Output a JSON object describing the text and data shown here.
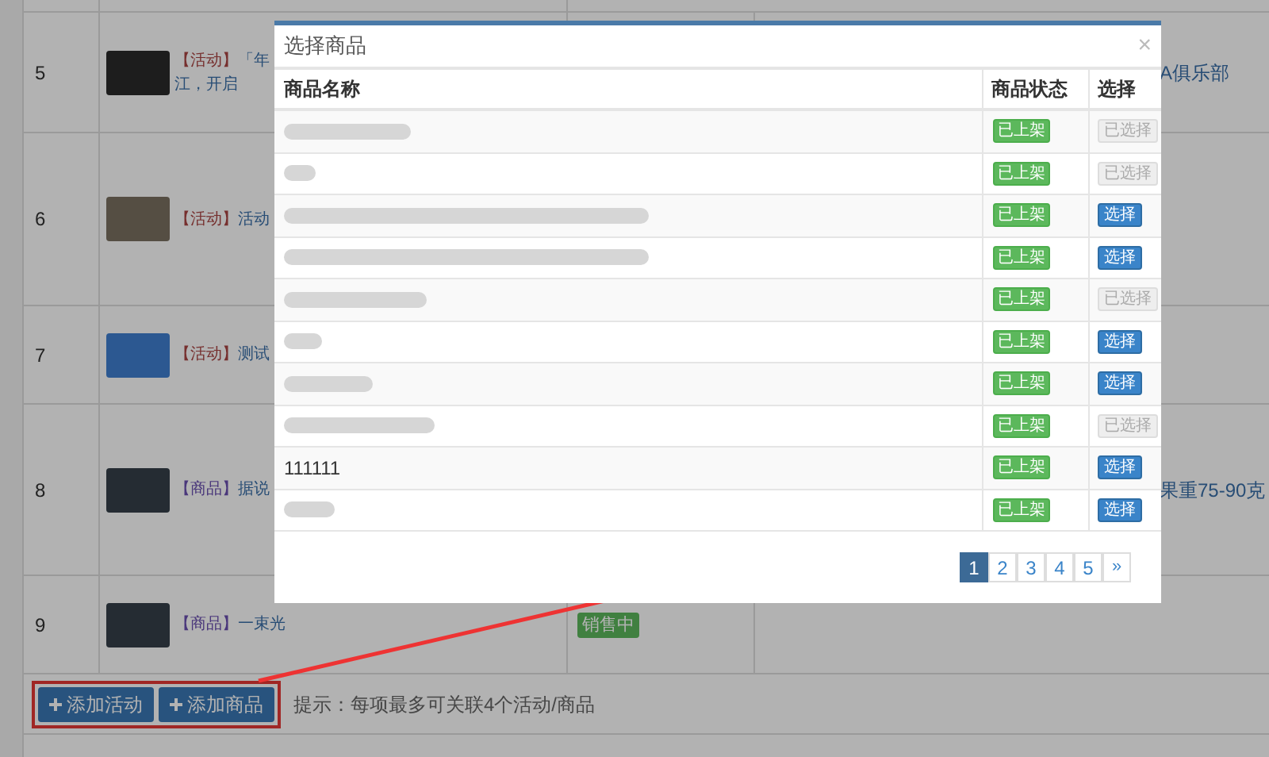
{
  "background_table": {
    "rows": [
      {
        "number": "5",
        "kind": "activity",
        "tag": "【活动】",
        "title_lines": [
          "「年",
          "江，开启"
        ],
        "extra": "A俱乐部"
      },
      {
        "number": "6",
        "kind": "activity",
        "tag": "【活动】",
        "title_lines": [
          "活动"
        ]
      },
      {
        "number": "7",
        "kind": "activity",
        "tag": "【活动】",
        "title_lines": [
          "测试"
        ]
      },
      {
        "number": "8",
        "kind": "product",
        "tag": "【商品】",
        "title_lines": [
          "据说"
        ],
        "extra": "果重75-90克"
      },
      {
        "number": "9",
        "kind": "product",
        "tag": "【商品】",
        "title_lines": [
          "一束光"
        ],
        "status": "销售中"
      }
    ]
  },
  "footer": {
    "buttons": [
      "添加活动",
      "添加商品"
    ],
    "hint": "提示：每项最多可关联4个活动/商品"
  },
  "modal": {
    "title": "选择商品",
    "close": "×",
    "columns": [
      "商品名称",
      "商品状态",
      "选择"
    ],
    "rows": [
      {
        "kind": "blurred",
        "status": "已上架",
        "action": "已选择",
        "selected": true
      },
      {
        "kind": "blurred",
        "status": "已上架",
        "action": "已选择",
        "selected": true
      },
      {
        "kind": "blurred",
        "status": "已上架",
        "action": "选择",
        "selected": false
      },
      {
        "kind": "blurred",
        "status": "已上架",
        "action": "选择",
        "selected": false
      },
      {
        "kind": "blurred",
        "status": "已上架",
        "action": "已选择",
        "selected": true
      },
      {
        "kind": "blurred",
        "status": "已上架",
        "action": "选择",
        "selected": false
      },
      {
        "kind": "blurred",
        "status": "已上架",
        "action": "选择",
        "selected": false
      },
      {
        "kind": "blurred",
        "status": "已上架",
        "action": "已选择",
        "selected": true
      },
      {
        "kind": "text",
        "name": "111111",
        "status": "已上架",
        "action": "选择",
        "selected": false
      },
      {
        "kind": "blurred",
        "status": "已上架",
        "action": "选择",
        "selected": false
      }
    ],
    "pagination": {
      "pages": [
        {
          "label": "1",
          "selected": true
        },
        {
          "label": "2",
          "selected": false
        },
        {
          "label": "3",
          "selected": false
        },
        {
          "label": "4",
          "selected": false
        },
        {
          "label": "5",
          "selected": false
        }
      ],
      "next": "»"
    }
  }
}
